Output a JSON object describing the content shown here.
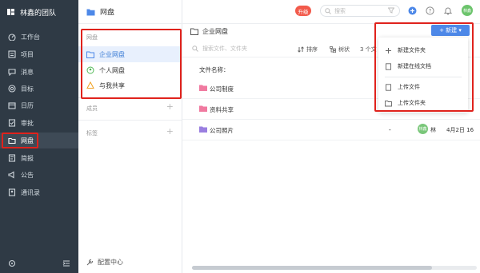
{
  "team": {
    "name": "林鑫的团队"
  },
  "nav": [
    {
      "label": "工作台",
      "icon": "dashboard-icon"
    },
    {
      "label": "项目",
      "icon": "project-icon"
    },
    {
      "label": "消息",
      "icon": "message-icon"
    },
    {
      "label": "目标",
      "icon": "target-icon"
    },
    {
      "label": "日历",
      "icon": "calendar-icon"
    },
    {
      "label": "审批",
      "icon": "approval-icon"
    },
    {
      "label": "网盘",
      "icon": "folder-icon",
      "active": true
    },
    {
      "label": "简报",
      "icon": "report-icon"
    },
    {
      "label": "公告",
      "icon": "announcement-icon"
    },
    {
      "label": "通讯录",
      "icon": "contacts-icon"
    }
  ],
  "panel": {
    "title": "网盘",
    "section_drive": "网盘",
    "items": [
      {
        "label": "企业网盘",
        "icon": "enterprise-drive-icon",
        "selected": true
      },
      {
        "label": "个人网盘",
        "icon": "personal-drive-icon"
      },
      {
        "label": "与我共享",
        "icon": "shared-icon"
      }
    ],
    "section_members": "成员",
    "section_tags": "标签",
    "config": "配置中心"
  },
  "topbar": {
    "upgrade": "升级",
    "search_placeholder": "搜索",
    "avatar": "林鑫"
  },
  "main": {
    "title": "企业网盘",
    "new_button": "+ 新建 ▾",
    "search_placeholder": "搜索文件、文件夹",
    "sort_label": "排序",
    "tree_label": "树状",
    "count_label": "3 个文",
    "column_name": "文件名称：",
    "files": [
      {
        "name": "公司制度",
        "color": "#f07aa0",
        "dash": "",
        "owner": "",
        "date": ""
      },
      {
        "name": "资料共享",
        "color": "#f07aa0",
        "dash": "",
        "owner": "",
        "date": ""
      },
      {
        "name": "公司照片",
        "color": "#9a7fe0",
        "dash": "-",
        "avatar": "林鑫",
        "owner": "林",
        "date": "4月2日 16"
      }
    ]
  },
  "dropdown": {
    "items": [
      {
        "label": "新建文件夹",
        "icon": "new-folder-icon"
      },
      {
        "label": "新建在线文档",
        "icon": "new-doc-icon"
      },
      {
        "label": "上传文件",
        "icon": "upload-file-icon"
      },
      {
        "label": "上传文件夹",
        "icon": "upload-folder-icon"
      }
    ]
  },
  "colors": {
    "sidebar": "#2f3a45",
    "accent": "#4d88e8",
    "highlight": "#e0221c"
  }
}
